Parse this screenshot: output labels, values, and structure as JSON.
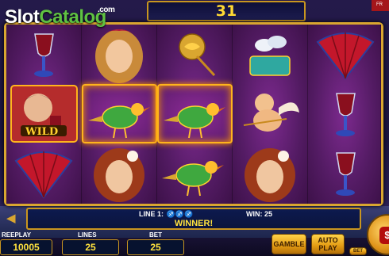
{
  "brand": {
    "name_part1": "Slot",
    "name_part2": "Catalog",
    "suffix": ".com"
  },
  "top_display": {
    "value": "31"
  },
  "reels": [
    [
      "wine-glass",
      "wild-man",
      "fan"
    ],
    [
      "woman-blonde",
      "golden-bird",
      "woman-redhead"
    ],
    [
      "golden-rose",
      "golden-bird",
      "golden-bird"
    ],
    [
      "doves-box",
      "cupid",
      "woman-redhead"
    ],
    [
      "fan",
      "wine-glass",
      "wine-glass"
    ]
  ],
  "winning_cells": [
    [
      1,
      1
    ],
    [
      2,
      1
    ]
  ],
  "wild_label": "WILD",
  "info": {
    "line_label": "LINE 1:",
    "win_label": "WIN: 25",
    "status": "WINNER!"
  },
  "stats": {
    "freeplay_label": "REEPLAY",
    "freeplay_value": "10005",
    "lines_label": "LINES",
    "lines_value": "25",
    "bet_label": "BET",
    "bet_value": "25"
  },
  "buttons": {
    "gamble": "GAMBLE",
    "autoplay_line1": "AUTO",
    "autoplay_line2": "PLAY",
    "bet_small": "BET",
    "spin_symbol": "$"
  },
  "colors": {
    "accent_gold": "#d9a630",
    "win_text": "#ffe23d",
    "reel_bg": "#5a1d6e"
  }
}
